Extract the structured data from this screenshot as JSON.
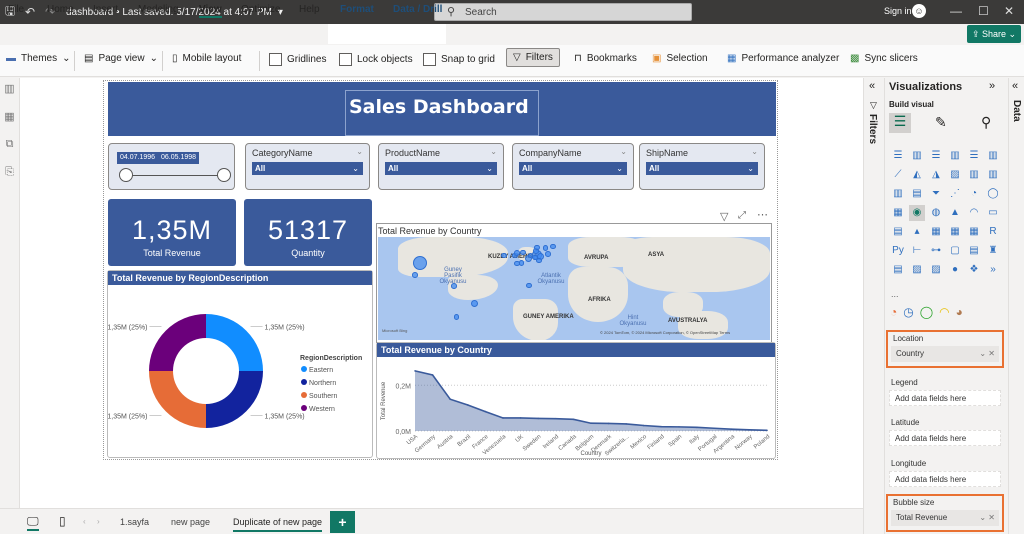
{
  "titlebar": {
    "doc_title": "dashboard • Last saved: 5/17/2024 at 4:07 PM",
    "search_placeholder": "Search",
    "sign_in": "Sign in"
  },
  "menu": [
    "File",
    "Home",
    "Insert",
    "Modeling",
    "View",
    "Optimize",
    "Help",
    "Format",
    "Data / Drill"
  ],
  "share_label": "Share",
  "ribbon": {
    "themes": "Themes",
    "page_view": "Page view",
    "mobile_layout": "Mobile layout",
    "gridlines": "Gridlines",
    "lock_objects": "Lock objects",
    "snap_to_grid": "Snap to grid",
    "filters": "Filters",
    "bookmarks": "Bookmarks",
    "selection": "Selection",
    "performance_analyzer": "Performance analyzer",
    "sync_slicers": "Sync slicers"
  },
  "dashboard": {
    "title": "Sales Dashboard",
    "date_slicer": {
      "start": "04.07.1996",
      "end": "06.05.1998"
    },
    "slicers": [
      {
        "label": "CategoryName",
        "value": "All"
      },
      {
        "label": "ProductName",
        "value": "All"
      },
      {
        "label": "CompanyName",
        "value": "All"
      },
      {
        "label": "ShipName",
        "value": "All"
      }
    ],
    "cards": [
      {
        "value": "1,35M",
        "caption": "Total Revenue"
      },
      {
        "value": "51317",
        "caption": "Quantity"
      }
    ],
    "donut_title": "Total Revenue by RegionDescription",
    "map_title": "Total Revenue by Country",
    "area_title": "Total Revenue by Country",
    "map_labels": {
      "north_america": "KUZEY AMERIKA",
      "europe": "AVRUPA",
      "asia": "ASYA",
      "africa": "AFRIKA",
      "south_america": "GUNEY AMERIKA",
      "australia": "AVUSTRALYA",
      "pacific": "Guney Pasifik Okyanusu",
      "atlantic": "Atlantik Okyanusu",
      "indian": "Hint Okyanusu",
      "attribution": "© 2024 TomTom, © 2024 Microsoft Corporation, © OpenStreetMap  Terms",
      "bing": "Microsoft Bing"
    }
  },
  "chart_data": [
    {
      "type": "pie",
      "title": "Total Revenue by RegionDescription",
      "legend_title": "RegionDescription",
      "legend_position": "right",
      "categories": [
        "Eastern",
        "Northern",
        "Southern",
        "Western"
      ],
      "values": [
        25,
        25,
        25,
        25
      ],
      "data_labels": [
        "1,35M (25%)",
        "1,35M (25%)",
        "1,35M (25%)",
        "1,35M (25%)"
      ],
      "colors": [
        "#118dff",
        "#12239e",
        "#e66c37",
        "#6b007b"
      ]
    },
    {
      "type": "area",
      "title": "Total Revenue by Country",
      "xlabel": "Country",
      "ylabel": "Total Revenue",
      "categories": [
        "USA",
        "Germany",
        "Austria",
        "Brazil",
        "France",
        "Venezuela",
        "UK",
        "Sweden",
        "Ireland",
        "Canada",
        "Belgium",
        "Denmark",
        "Switzerla...",
        "Mexico",
        "Finland",
        "Spain",
        "Italy",
        "Portugal",
        "Argentina",
        "Norway",
        "Poland"
      ],
      "values": [
        0.263,
        0.245,
        0.139,
        0.114,
        0.085,
        0.057,
        0.057,
        0.055,
        0.054,
        0.051,
        0.034,
        0.033,
        0.031,
        0.024,
        0.019,
        0.018,
        0.016,
        0.012,
        0.008,
        0.005,
        0.003
      ],
      "unit": "M",
      "yticks": [
        "0,0M",
        "0,2M"
      ],
      "ylim": [
        0,
        0.28
      ],
      "grid": true
    }
  ],
  "viz_pane": {
    "title": "Visualizations",
    "build_visual": "Build visual",
    "more": "...",
    "filters_label": "Filters",
    "data_label": "Data",
    "wells": [
      {
        "label": "Location",
        "value": "Country",
        "filled": true
      },
      {
        "label": "Legend",
        "value": "Add data fields here",
        "filled": false
      },
      {
        "label": "Latitude",
        "value": "Add data fields here",
        "filled": false
      },
      {
        "label": "Longitude",
        "value": "Add data fields here",
        "filled": false
      },
      {
        "label": "Bubble size",
        "value": "Total Revenue",
        "filled": true
      }
    ]
  },
  "pages": [
    "1.sayfa",
    "new page",
    "Duplicate of new page"
  ],
  "add_page": "+"
}
